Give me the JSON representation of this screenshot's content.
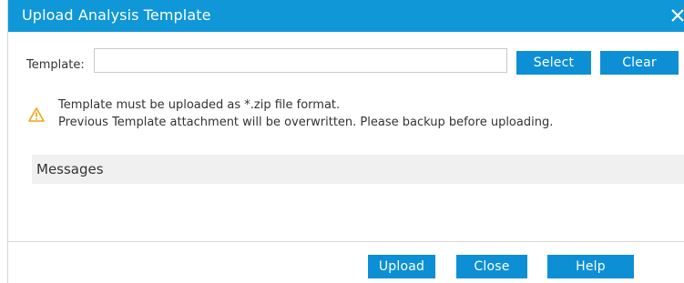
{
  "dialog": {
    "title": "Upload Analysis Template",
    "close_icon": "close-icon"
  },
  "template": {
    "label": "Template:",
    "value": "",
    "placeholder": ""
  },
  "buttons": {
    "select": "Select",
    "clear": "Clear",
    "upload": "Upload",
    "close": "Close",
    "help": "Help"
  },
  "notice": {
    "icon": "warning-icon",
    "line1": "Template must be uploaded as *.zip file format.",
    "line2": "Previous Template attachment will be overwritten. Please backup before uploading."
  },
  "messages": {
    "header": "Messages"
  },
  "colors": {
    "titlebar": "#0f97d8",
    "button": "#0d8fd6",
    "warning": "#f2a516"
  }
}
